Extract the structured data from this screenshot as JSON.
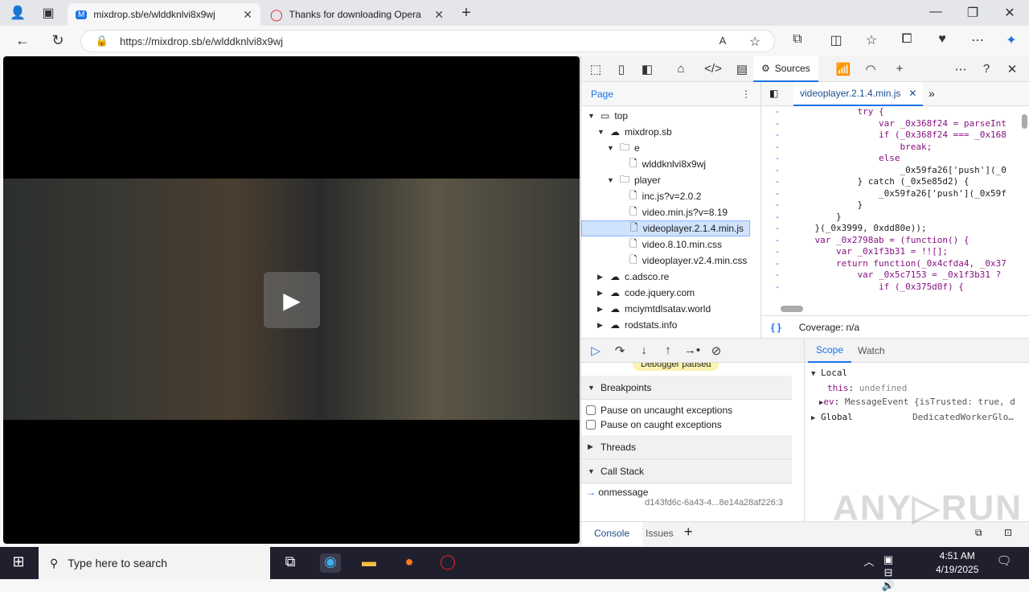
{
  "browser": {
    "tabs": [
      {
        "title": "mixdrop.sb/e/wlddknlvi8x9wj",
        "active": true
      },
      {
        "title": "Thanks for downloading Opera",
        "active": false
      }
    ],
    "url": "https://mixdrop.sb/e/wlddknlvi8x9wj"
  },
  "devtools": {
    "active_panel": "Sources",
    "page_tab": "Page",
    "tree": [
      {
        "label": "top",
        "depth": 0,
        "icon": "frame",
        "open": true
      },
      {
        "label": "mixdrop.sb",
        "depth": 1,
        "icon": "cloud",
        "open": true
      },
      {
        "label": "e",
        "depth": 2,
        "icon": "folder",
        "open": true
      },
      {
        "label": "wlddknlvi8x9wj",
        "depth": 3,
        "icon": "file"
      },
      {
        "label": "player",
        "depth": 2,
        "icon": "folder",
        "open": true
      },
      {
        "label": "inc.js?v=2.0.2",
        "depth": 3,
        "icon": "file"
      },
      {
        "label": "video.min.js?v=8.19",
        "depth": 3,
        "icon": "file"
      },
      {
        "label": "videoplayer.2.1.4.min.js",
        "depth": 3,
        "icon": "file",
        "selected": true
      },
      {
        "label": "video.8.10.min.css",
        "depth": 3,
        "icon": "file"
      },
      {
        "label": "videoplayer.v2.4.min.css",
        "depth": 3,
        "icon": "file"
      },
      {
        "label": "c.adsco.re",
        "depth": 1,
        "icon": "cloud",
        "open": false
      },
      {
        "label": "code.jquery.com",
        "depth": 1,
        "icon": "cloud",
        "open": false
      },
      {
        "label": "mciymtdlsatav.world",
        "depth": 1,
        "icon": "cloud",
        "open": false
      },
      {
        "label": "rodstats.info",
        "depth": 1,
        "icon": "cloud",
        "open": false
      }
    ],
    "file_tab": "videoplayer.2.1.4.min.js",
    "code_lines": [
      "            try {",
      "                var _0x368f24 = parseInt",
      "                if (_0x368f24 === _0x168",
      "                    break;",
      "                else",
      "                    _0x59fa26['push'](_0",
      "            } catch (_0x5e85d2) {",
      "                _0x59fa26['push'](_0x59f",
      "            }",
      "        }",
      "    }(_0x3999, 0xdd80e));",
      "    var _0x2798ab = (function() {",
      "        var _0x1f3b31 = !![];",
      "        return function(_0x4cfda4, _0x37",
      "            var _0x5c7153 = _0x1f3b31 ? ",
      "                if (_0x375d0f) {"
    ],
    "coverage": "Coverage: n/a",
    "paused_badge": "Debugger paused",
    "breakpoints_label": "Breakpoints",
    "pause_uncaught": "Pause on uncaught exceptions",
    "pause_caught": "Pause on caught exceptions",
    "threads_label": "Threads",
    "callstack_label": "Call Stack",
    "callstack": [
      {
        "fn": "onmessage",
        "loc": "d143fd6c-6a43-4...8e14a28af226:3"
      }
    ],
    "scope_tabs": [
      "Scope",
      "Watch"
    ],
    "scope": {
      "local": "Local",
      "this_key": "this",
      "this_val": "undefined",
      "ev_key": "ev",
      "ev_val": "MessageEvent {isTrusted: true, d",
      "global": "Global",
      "global_val": "DedicatedWorkerGlo…"
    },
    "drawer_tabs": [
      "Console",
      "Issues"
    ]
  },
  "taskbar": {
    "search_placeholder": "Type here to search",
    "time": "4:51 AM",
    "date": "4/19/2025"
  },
  "watermark": "ANY RUN"
}
